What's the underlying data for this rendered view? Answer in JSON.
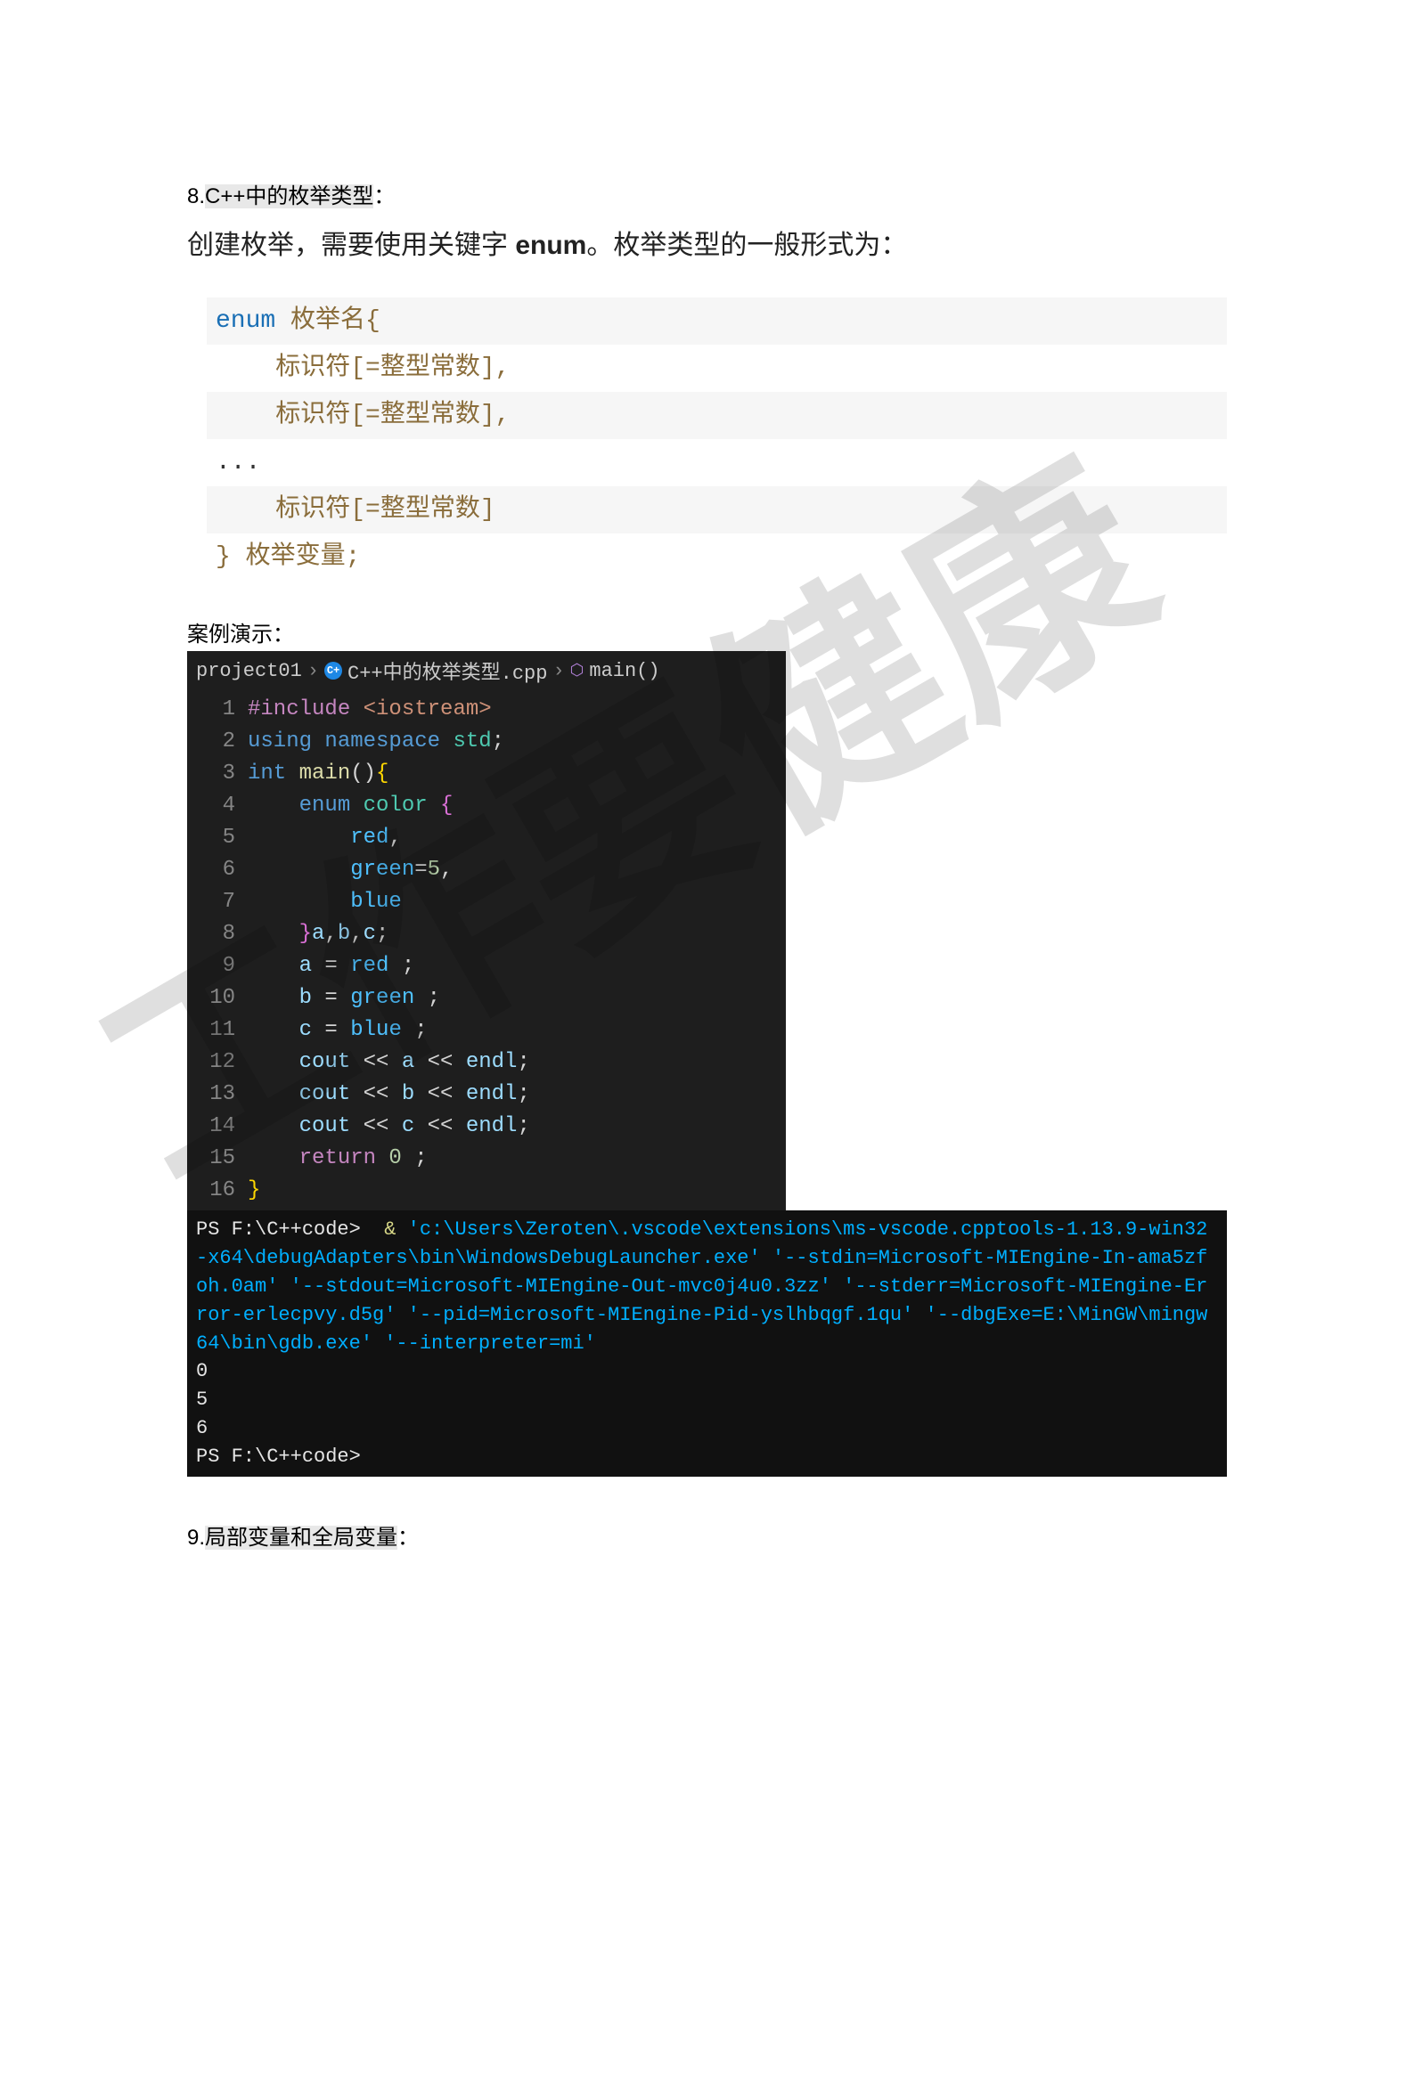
{
  "section8": {
    "prefix": "8.",
    "title_hl": "C++中的枚举类型",
    "title_suffix": "：",
    "desc_pre": "创建枚举，需要使用关键字 ",
    "desc_bold": "enum",
    "desc_post": "。枚举类型的一般形式为："
  },
  "syntax": {
    "l1_kw": "enum",
    "l1_name": " 枚举名{",
    "l2": "标识符[=整型常数],",
    "l3": "标识符[=整型常数],",
    "l4": "...",
    "l5": "标识符[=整型常数]",
    "l6": "} 枚举变量;"
  },
  "demo_label": "案例演示：",
  "breadcrumb": {
    "p1": "project01",
    "p2": "C++中的枚举类型.cpp",
    "p3": "main()"
  },
  "code": {
    "lines": [
      "1",
      "2",
      "3",
      "4",
      "5",
      "6",
      "7",
      "8",
      "9",
      "10",
      "11",
      "12",
      "13",
      "14",
      "15",
      "16"
    ],
    "l1_a": "#include",
    "l1_b": " <iostream>",
    "l2_a": "using",
    "l2_b": " namespace",
    "l2_c": " std",
    "l2_d": ";",
    "l3_a": "int",
    "l3_b": " main",
    "l3_c": "()",
    "l3_d": "{",
    "l4_a": "    enum",
    "l4_b": " color",
    "l4_c": " {",
    "l5": "        red",
    "l5_c": ",",
    "l6_a": "        green",
    "l6_b": "=",
    "l6_c": "5",
    "l6_d": ",",
    "l7": "        blue",
    "l8_a": "    }",
    "l8_b": "a",
    "l8_c": ",",
    "l8_d": "b",
    "l8_e": ",",
    "l8_f": "c",
    "l8_g": ";",
    "l9_a": "    a",
    "l9_b": " = ",
    "l9_c": "red",
    "l9_d": " ;",
    "l10_a": "    b",
    "l10_b": " = ",
    "l10_c": "green",
    "l10_d": " ;",
    "l11_a": "    c",
    "l11_b": " = ",
    "l11_c": "blue",
    "l11_d": " ;",
    "l12_a": "    cout",
    "l12_b": " << ",
    "l12_c": "a",
    "l12_d": " << ",
    "l12_e": "endl",
    "l12_f": ";",
    "l13_a": "    cout",
    "l13_b": " << ",
    "l13_c": "b",
    "l13_d": " << ",
    "l13_e": "endl",
    "l13_f": ";",
    "l14_a": "    cout",
    "l14_b": " << ",
    "l14_c": "c",
    "l14_d": " << ",
    "l14_e": "endl",
    "l14_f": ";",
    "l15_a": "    return",
    "l15_b": " 0",
    "l15_c": " ;",
    "l16": "}"
  },
  "terminal": {
    "ps1_a": "PS F:\\C++code>  ",
    "amp": "&",
    "cmd": " 'c:\\Users\\Zeroten\\.vscode\\extensions\\ms-vscode.cpptools-1.13.9-win32-x64\\debugAdapters\\bin\\WindowsDebugLauncher.exe' '--stdin=Microsoft-MIEngine-In-ama5zfoh.0am' '--stdout=Microsoft-MIEngine-Out-mvc0j4u0.3zz' '--stderr=Microsoft-MIEngine-Error-erlecpvy.d5g' '--pid=Microsoft-MIEngine-Pid-yslhbqgf.1qu' '--dbgExe=E:\\MinGW\\mingw64\\bin\\gdb.exe' '--interpreter=mi'",
    "out1": "0",
    "out2": "5",
    "out3": "6",
    "ps2": "PS F:\\C++code>"
  },
  "section9": {
    "prefix": "9.",
    "title_hl": "局部变量和全局变量",
    "title_suffix": "："
  }
}
